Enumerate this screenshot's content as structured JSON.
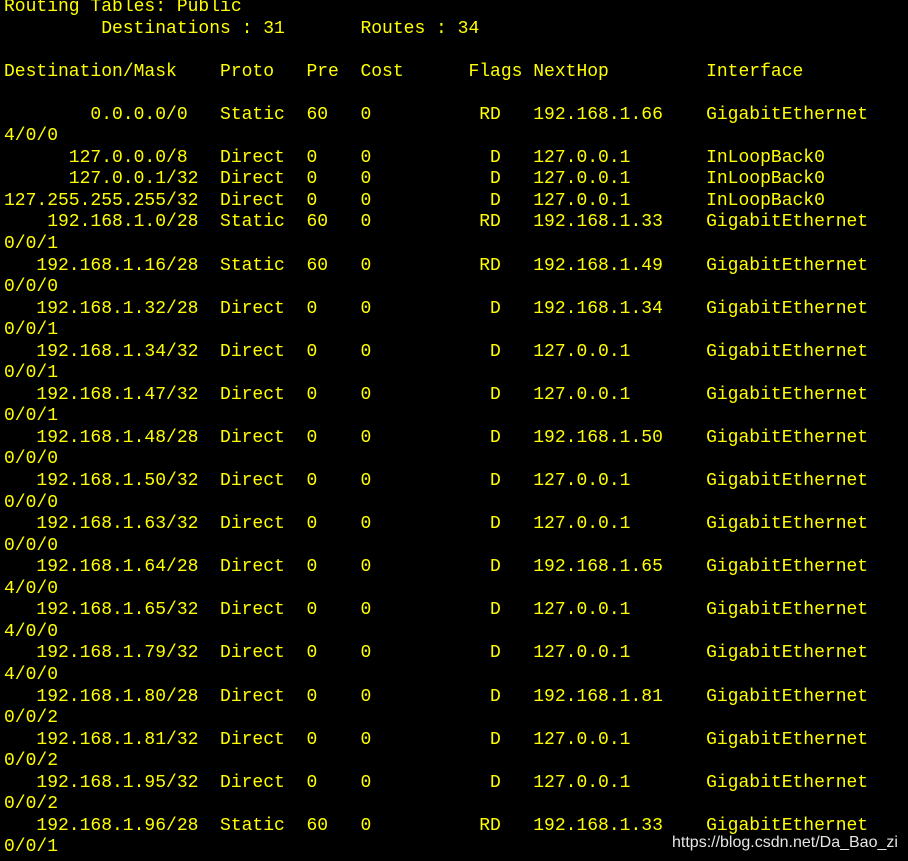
{
  "colors": {
    "background": "#000000",
    "text": "#ffff00",
    "watermark": "#e6e6e6"
  },
  "routing_table": {
    "title": "Routing Tables: Public",
    "summary": {
      "destinations_label": "Destinations :",
      "destinations": 31,
      "routes_label": "Routes :",
      "routes": 34
    },
    "columns": [
      "Destination/Mask",
      "Proto",
      "Pre",
      "Cost",
      "Flags",
      "NextHop",
      "Interface"
    ],
    "rows": [
      {
        "destination": "0.0.0.0/0",
        "proto": "Static",
        "pre": 60,
        "cost": 0,
        "flags": "RD",
        "nexthop": "192.168.1.66",
        "interface": "GigabitEthernet",
        "interface_wrap": "4/0/0"
      },
      {
        "destination": "127.0.0.0/8",
        "proto": "Direct",
        "pre": 0,
        "cost": 0,
        "flags": "D",
        "nexthop": "127.0.0.1",
        "interface": "InLoopBack0"
      },
      {
        "destination": "127.0.0.1/32",
        "proto": "Direct",
        "pre": 0,
        "cost": 0,
        "flags": "D",
        "nexthop": "127.0.0.1",
        "interface": "InLoopBack0"
      },
      {
        "destination": "127.255.255.255/32",
        "proto": "Direct",
        "pre": 0,
        "cost": 0,
        "flags": "D",
        "nexthop": "127.0.0.1",
        "interface": "InLoopBack0"
      },
      {
        "destination": "192.168.1.0/28",
        "proto": "Static",
        "pre": 60,
        "cost": 0,
        "flags": "RD",
        "nexthop": "192.168.1.33",
        "interface": "GigabitEthernet",
        "interface_wrap": "0/0/1"
      },
      {
        "destination": "192.168.1.16/28",
        "proto": "Static",
        "pre": 60,
        "cost": 0,
        "flags": "RD",
        "nexthop": "192.168.1.49",
        "interface": "GigabitEthernet",
        "interface_wrap": "0/0/0"
      },
      {
        "destination": "192.168.1.32/28",
        "proto": "Direct",
        "pre": 0,
        "cost": 0,
        "flags": "D",
        "nexthop": "192.168.1.34",
        "interface": "GigabitEthernet",
        "interface_wrap": "0/0/1"
      },
      {
        "destination": "192.168.1.34/32",
        "proto": "Direct",
        "pre": 0,
        "cost": 0,
        "flags": "D",
        "nexthop": "127.0.0.1",
        "interface": "GigabitEthernet",
        "interface_wrap": "0/0/1"
      },
      {
        "destination": "192.168.1.47/32",
        "proto": "Direct",
        "pre": 0,
        "cost": 0,
        "flags": "D",
        "nexthop": "127.0.0.1",
        "interface": "GigabitEthernet",
        "interface_wrap": "0/0/1"
      },
      {
        "destination": "192.168.1.48/28",
        "proto": "Direct",
        "pre": 0,
        "cost": 0,
        "flags": "D",
        "nexthop": "192.168.1.50",
        "interface": "GigabitEthernet",
        "interface_wrap": "0/0/0"
      },
      {
        "destination": "192.168.1.50/32",
        "proto": "Direct",
        "pre": 0,
        "cost": 0,
        "flags": "D",
        "nexthop": "127.0.0.1",
        "interface": "GigabitEthernet",
        "interface_wrap": "0/0/0"
      },
      {
        "destination": "192.168.1.63/32",
        "proto": "Direct",
        "pre": 0,
        "cost": 0,
        "flags": "D",
        "nexthop": "127.0.0.1",
        "interface": "GigabitEthernet",
        "interface_wrap": "0/0/0"
      },
      {
        "destination": "192.168.1.64/28",
        "proto": "Direct",
        "pre": 0,
        "cost": 0,
        "flags": "D",
        "nexthop": "192.168.1.65",
        "interface": "GigabitEthernet",
        "interface_wrap": "4/0/0"
      },
      {
        "destination": "192.168.1.65/32",
        "proto": "Direct",
        "pre": 0,
        "cost": 0,
        "flags": "D",
        "nexthop": "127.0.0.1",
        "interface": "GigabitEthernet",
        "interface_wrap": "4/0/0"
      },
      {
        "destination": "192.168.1.79/32",
        "proto": "Direct",
        "pre": 0,
        "cost": 0,
        "flags": "D",
        "nexthop": "127.0.0.1",
        "interface": "GigabitEthernet",
        "interface_wrap": "4/0/0"
      },
      {
        "destination": "192.168.1.80/28",
        "proto": "Direct",
        "pre": 0,
        "cost": 0,
        "flags": "D",
        "nexthop": "192.168.1.81",
        "interface": "GigabitEthernet",
        "interface_wrap": "0/0/2"
      },
      {
        "destination": "192.168.1.81/32",
        "proto": "Direct",
        "pre": 0,
        "cost": 0,
        "flags": "D",
        "nexthop": "127.0.0.1",
        "interface": "GigabitEthernet",
        "interface_wrap": "0/0/2"
      },
      {
        "destination": "192.168.1.95/32",
        "proto": "Direct",
        "pre": 0,
        "cost": 0,
        "flags": "D",
        "nexthop": "127.0.0.1",
        "interface": "GigabitEthernet",
        "interface_wrap": "0/0/2"
      },
      {
        "destination": "192.168.1.96/28",
        "proto": "Static",
        "pre": 60,
        "cost": 0,
        "flags": "RD",
        "nexthop": "192.168.1.33",
        "interface": "GigabitEthernet",
        "interface_wrap": "0/0/1"
      }
    ]
  },
  "watermark": "https://blog.csdn.net/Da_Bao_zi"
}
